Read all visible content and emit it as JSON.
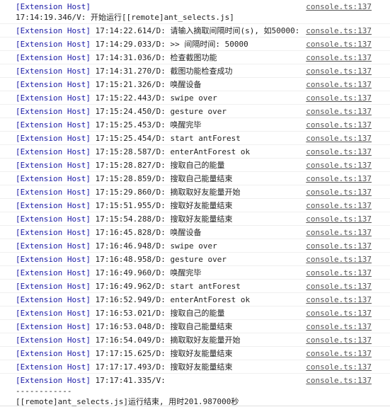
{
  "source": "console.ts:137",
  "messages": [
    {
      "tag": "[Extension Host]",
      "body": "\n17:14:19.346/V: 开始运行[[remote]ant_selects.js]"
    },
    {
      "tag": "[Extension Host]",
      "body": " 17:14:22.614/D: 请输入摘取间隔时间(s), 如50000:"
    },
    {
      "tag": "[Extension Host]",
      "body": " 17:14:29.033/D: >> 间隔时间: 50000"
    },
    {
      "tag": "[Extension Host]",
      "body": " 17:14:31.036/D: 检查截图功能"
    },
    {
      "tag": "[Extension Host]",
      "body": " 17:14:31.270/D: 截图功能检查成功"
    },
    {
      "tag": "[Extension Host]",
      "body": " 17:15:21.326/D: 唤醒设备"
    },
    {
      "tag": "[Extension Host]",
      "body": " 17:15:22.443/D: swipe over"
    },
    {
      "tag": "[Extension Host]",
      "body": " 17:15:24.450/D: gesture over"
    },
    {
      "tag": "[Extension Host]",
      "body": " 17:15:25.453/D: 唤醒完毕"
    },
    {
      "tag": "[Extension Host]",
      "body": " 17:15:25.454/D: start antForest"
    },
    {
      "tag": "[Extension Host]",
      "body": " 17:15:28.587/D: enterAntForest ok"
    },
    {
      "tag": "[Extension Host]",
      "body": " 17:15:28.827/D: 搜取自己的能量"
    },
    {
      "tag": "[Extension Host]",
      "body": " 17:15:28.859/D: 搜取自己能量结束"
    },
    {
      "tag": "[Extension Host]",
      "body": " 17:15:29.860/D: 摘取取好友能量开始"
    },
    {
      "tag": "[Extension Host]",
      "body": " 17:15:51.955/D: 搜取好友能量结束"
    },
    {
      "tag": "[Extension Host]",
      "body": " 17:15:54.288/D: 搜取好友能量结束"
    },
    {
      "tag": "[Extension Host]",
      "body": " 17:16:45.828/D: 唤醒设备"
    },
    {
      "tag": "[Extension Host]",
      "body": " 17:16:46.948/D: swipe over"
    },
    {
      "tag": "[Extension Host]",
      "body": " 17:16:48.958/D: gesture over"
    },
    {
      "tag": "[Extension Host]",
      "body": " 17:16:49.960/D: 唤醒完毕"
    },
    {
      "tag": "[Extension Host]",
      "body": " 17:16:49.962/D: start antForest"
    },
    {
      "tag": "[Extension Host]",
      "body": " 17:16:52.949/D: enterAntForest ok"
    },
    {
      "tag": "[Extension Host]",
      "body": " 17:16:53.021/D: 搜取自己的能量"
    },
    {
      "tag": "[Extension Host]",
      "body": " 17:16:53.048/D: 搜取自己能量结束"
    },
    {
      "tag": "[Extension Host]",
      "body": " 17:16:54.049/D: 摘取取好友能量开始"
    },
    {
      "tag": "[Extension Host]",
      "body": " 17:17:15.625/D: 搜取好友能量结束"
    },
    {
      "tag": "[Extension Host]",
      "body": " 17:17:17.493/D: 搜取好友能量结束"
    },
    {
      "tag": "[Extension Host]",
      "body": " 17:17:41.335/V:\n------------\n[[remote]ant_selects.js]运行结束, 用时201.987000秒"
    }
  ]
}
